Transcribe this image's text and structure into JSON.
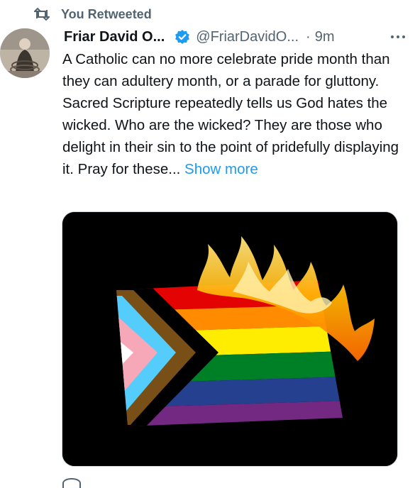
{
  "retweet": {
    "label": "You Retweeted",
    "icon": "retweet-icon"
  },
  "tweet": {
    "author_name": "Friar David O...",
    "verified_icon": "verified-badge-icon",
    "handle": "@FriarDavidO...",
    "time": "9m",
    "more_icon": "more-options-icon",
    "text": "A Catholic can no more celebrate pride month than they can adultery month, or a parade for gluttony. Sacred Scripture repeatedly tells us God hates the wicked. Who are the wicked? They are those who delight in their sin to the point of pridefully displaying it. Pray for these...",
    "show_more": "Show more",
    "media": {
      "description_icon": "burning-flag-image"
    }
  },
  "colors": {
    "text": "#0f1419",
    "secondary": "#536471",
    "link": "#1d9bf0",
    "verified": "#1d9bf0"
  }
}
